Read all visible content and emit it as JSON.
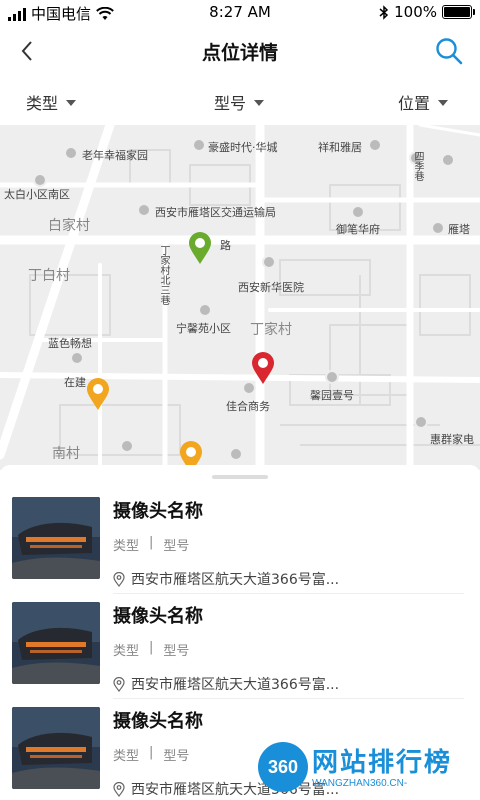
{
  "status_bar": {
    "carrier": "中国电信",
    "time": "8:27 AM",
    "battery_text": "100%",
    "battery_level": 1.0
  },
  "nav": {
    "title": "点位详情",
    "back_icon": "chevron-left-icon",
    "search_icon": "search-icon",
    "accent_color": "#1a8fd9"
  },
  "filters": [
    {
      "label": "类型"
    },
    {
      "label": "型号"
    },
    {
      "label": "位置"
    }
  ],
  "map": {
    "labels": {
      "laonian": "老年幸福家园",
      "haosheng": "豪盛时代·华城",
      "xianghe": "祥和雅居",
      "taibai": "太白小区南区",
      "baijiacun": "白家村",
      "jiaotong": "西安市雁塔区交通运输局",
      "yubi": "御笔华府",
      "yanta": "雁塔",
      "dingbaicun": "丁白村",
      "road_lu": "路",
      "xinhua": "西安新华医院",
      "ningxin": "宁馨苑小区",
      "dingjiacun": "丁家村",
      "lanse": "蓝色畅想",
      "zaijian": "在建",
      "jiahe": "佳合商务",
      "xinyuan": "馨园壹号",
      "huiqun": "惠群家电",
      "nancun": "南村",
      "dingjiacun_north_road": "丁家村北三巷",
      "sijixiang": "四季巷"
    },
    "pins": [
      {
        "name": "green-pin",
        "color": "#6aab2e"
      },
      {
        "name": "red-pin",
        "color": "#d9262f"
      },
      {
        "name": "orange-pin-1",
        "color": "#f2a51e"
      },
      {
        "name": "orange-pin-2",
        "color": "#f2a51e"
      }
    ]
  },
  "cameras": [
    {
      "name": "摄像头名称",
      "type": "类型",
      "separator": "|",
      "model": "型号",
      "address": "西安市雁塔区航天大道366号富..."
    },
    {
      "name": "摄像头名称",
      "type": "类型",
      "separator": "|",
      "model": "型号",
      "address": "西安市雁塔区航天大道366号富..."
    },
    {
      "name": "摄像头名称",
      "type": "类型",
      "separator": "|",
      "model": "型号",
      "address": "西安市雁塔区航天大道366号富..."
    }
  ],
  "watermark": {
    "logo": "360",
    "title": "网站排行榜",
    "url": "WANGZHAN360.CN-"
  }
}
